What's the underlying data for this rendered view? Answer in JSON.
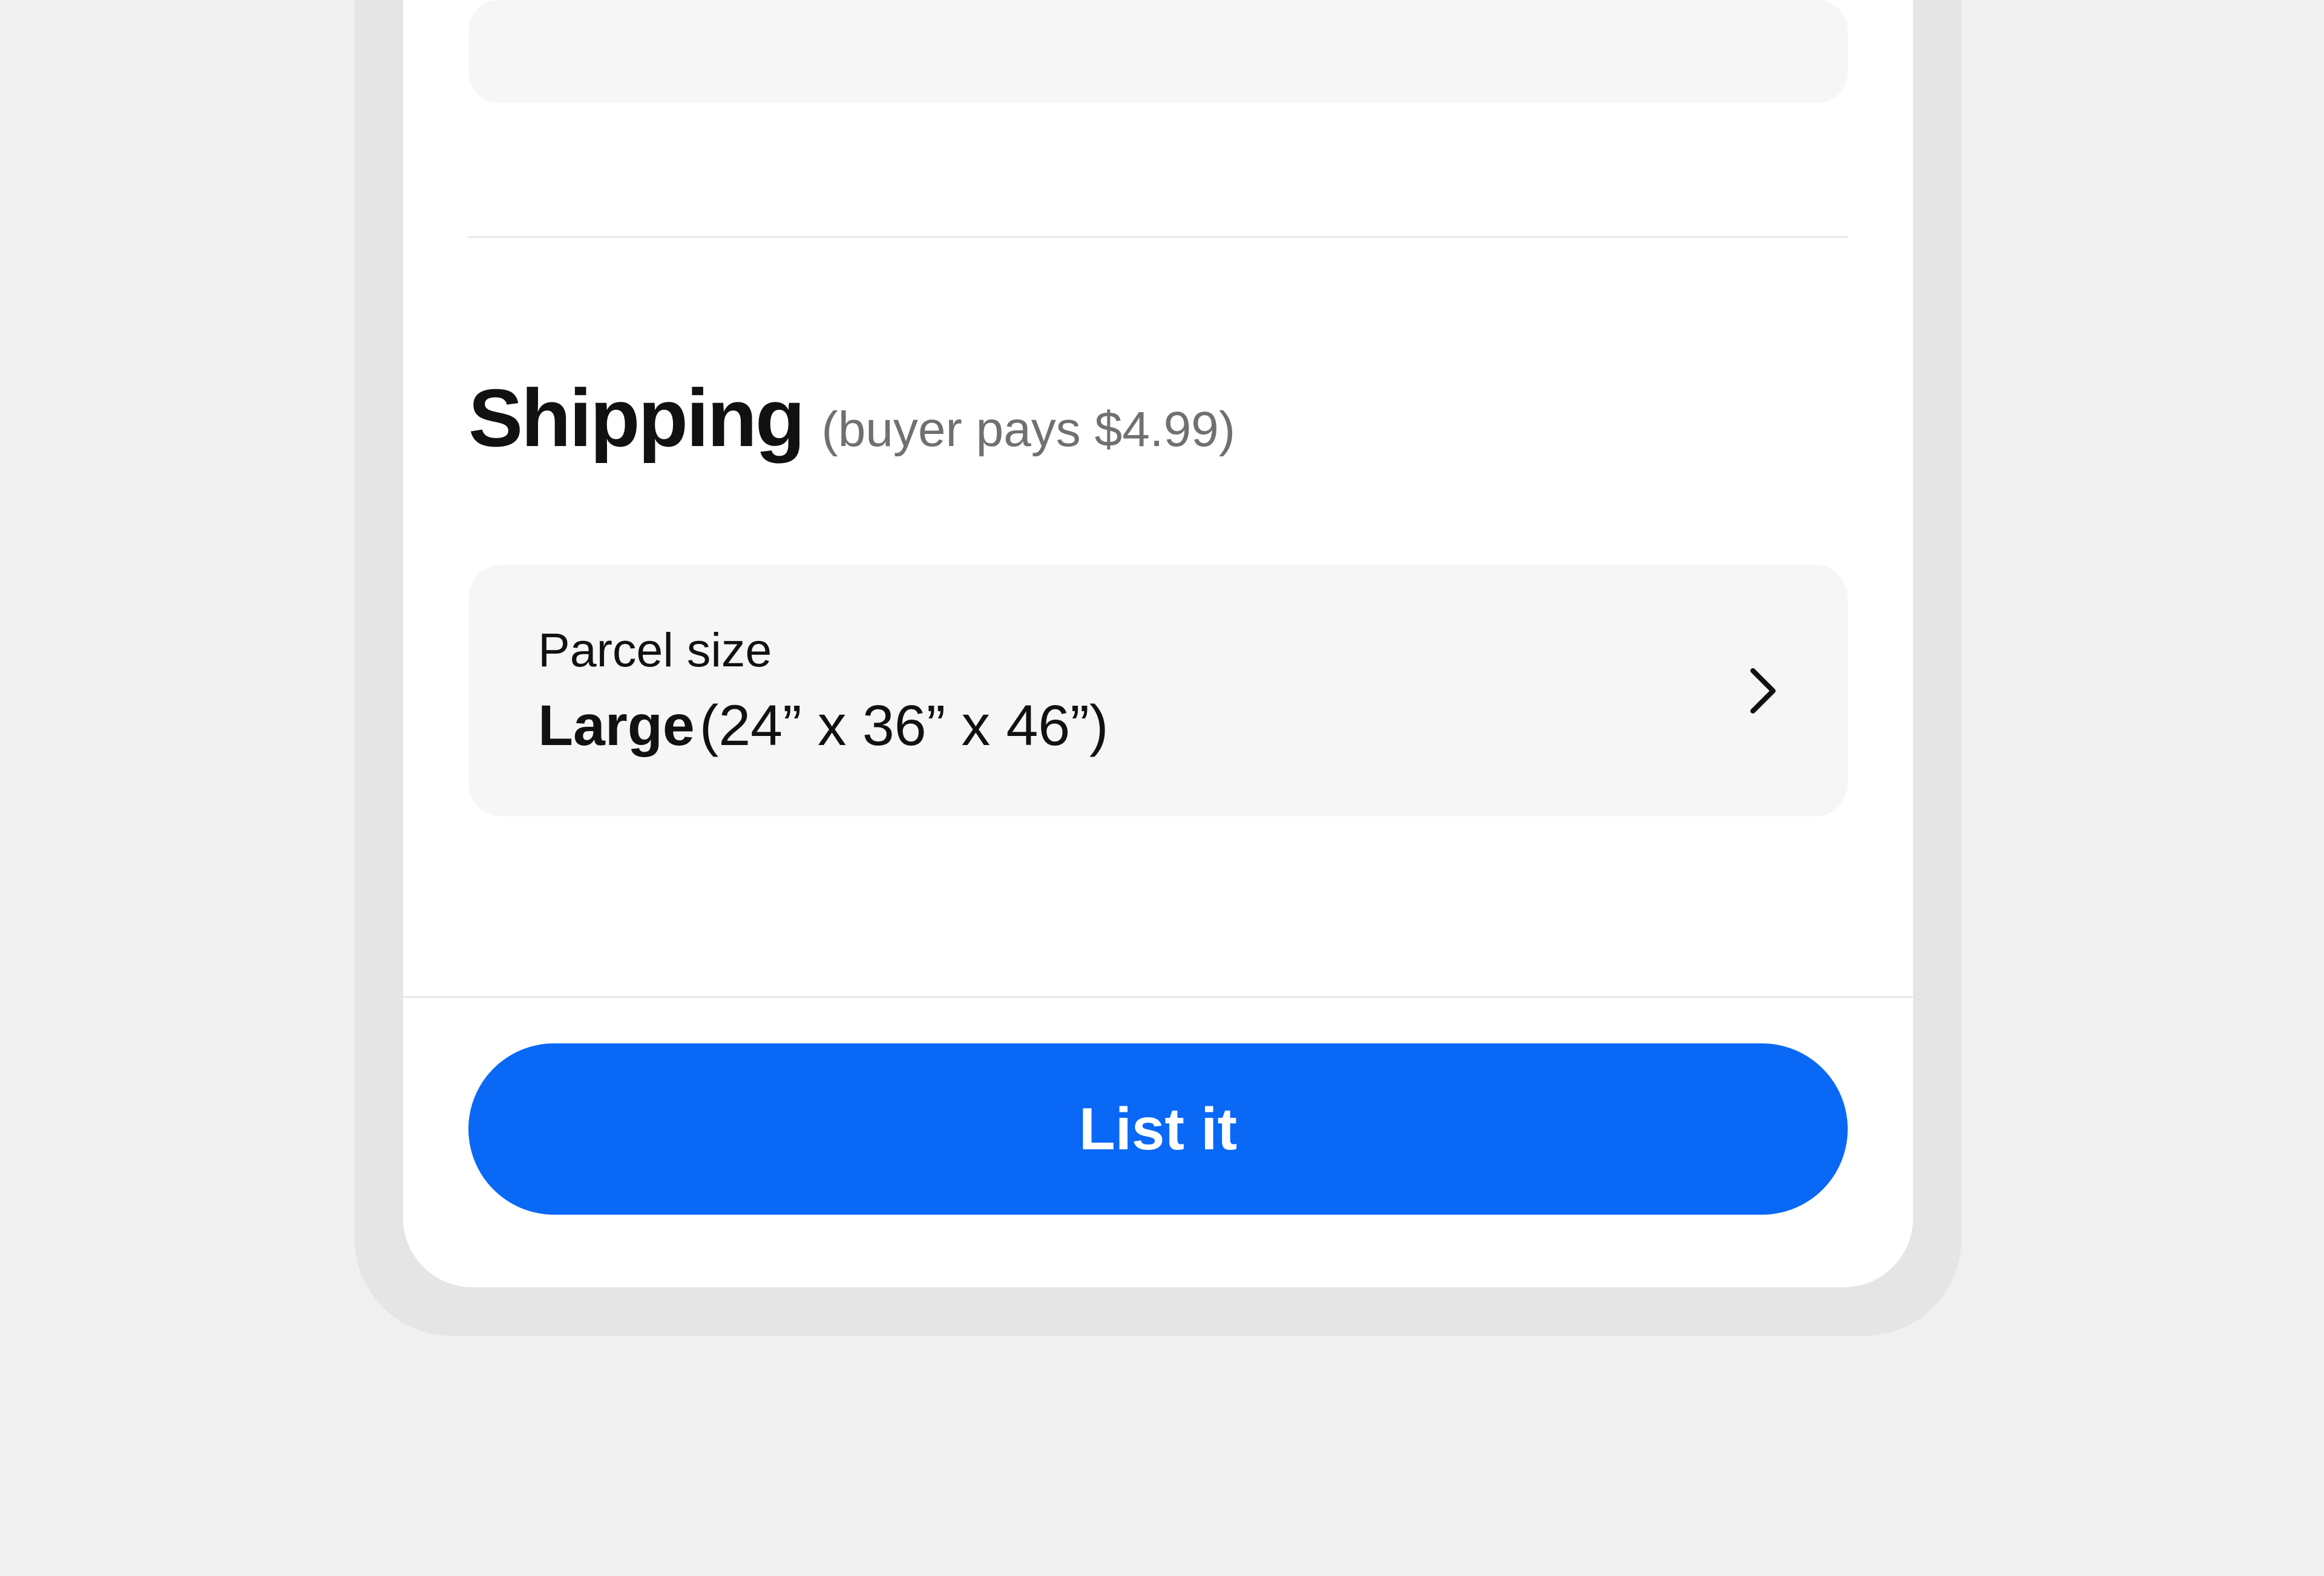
{
  "shipping": {
    "title": "Shipping",
    "subtitle": "(buyer pays $4.99)",
    "parcel": {
      "label": "Parcel size",
      "value_name": "Large",
      "value_dims": "(24” x 36” x 46”)"
    }
  },
  "footer": {
    "list_button_label": "List it"
  }
}
